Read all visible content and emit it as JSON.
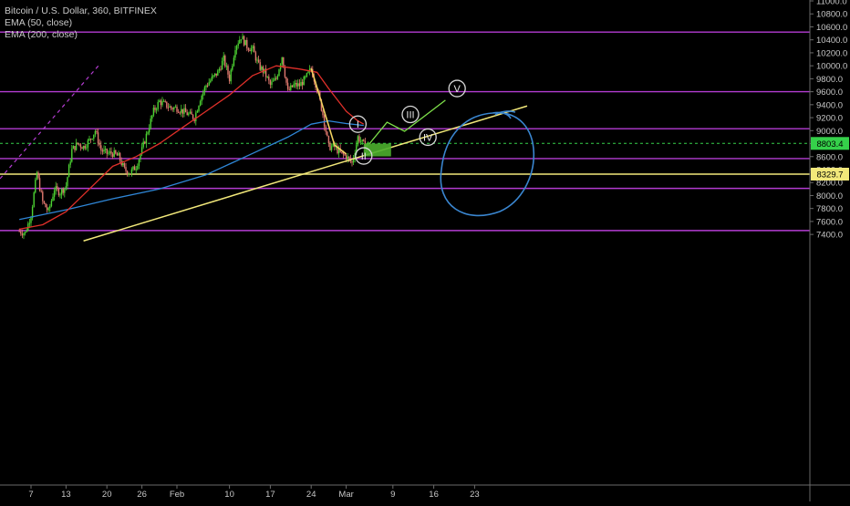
{
  "header": {
    "title": "Bitcoin / U.S. Dollar, 360, BITFINEX",
    "ema50_label": "EMA (50, close)",
    "ema200_label": "EMA (200, close)"
  },
  "colors": {
    "background": "#000000",
    "text": "#c8c8c8",
    "candle_up": "#4cd232",
    "candle_down": "#e0786e",
    "ema50": "#e0302a",
    "ema200": "#2f86d6",
    "levels": "#b43cd2",
    "trendline": "#f2e87a",
    "current_price_line": "#35d04a",
    "wave_annotation": "#7ee04a",
    "circle_annotation": "#3a86d0"
  },
  "chart_data": {
    "type": "candlestick",
    "title": "Bitcoin / U.S. Dollar, 360, BITFINEX",
    "xlabel": "",
    "ylabel": "",
    "ylim": [
      7300,
      11100
    ],
    "y_ticks": [
      "11000.0",
      "10800.0",
      "10600.0",
      "10400.0",
      "10200.0",
      "10000.0",
      "9800.0",
      "9600.0",
      "9400.0",
      "9200.0",
      "9000.0",
      "8800.0",
      "8600.0",
      "8400.0",
      "8200.0",
      "8000.0",
      "7800.0",
      "7600.0",
      "7400.0"
    ],
    "x_ticks": [
      "7",
      "13",
      "20",
      "26",
      "Feb",
      "10",
      "17",
      "24",
      "Mar",
      "9",
      "16",
      "23"
    ],
    "series": [
      {
        "name": "EMA (50, close)"
      },
      {
        "name": "EMA (200, close)"
      }
    ],
    "price_path": [
      [
        "Jan 5",
        7450
      ],
      [
        "Jan 6",
        7420
      ],
      [
        "Jan 7",
        7700
      ],
      [
        "Jan 8",
        8350
      ],
      [
        "Jan 9",
        7900
      ],
      [
        "Jan 10",
        7750
      ],
      [
        "Jan 11",
        8100
      ],
      [
        "Jan 12",
        8050
      ],
      [
        "Jan 13",
        8150
      ],
      [
        "Jan 14",
        8700
      ],
      [
        "Jan 15",
        8800
      ],
      [
        "Jan 16",
        8750
      ],
      [
        "Jan 17",
        8850
      ],
      [
        "Jan 18",
        9000
      ],
      [
        "Jan 19",
        8700
      ],
      [
        "Jan 20",
        8650
      ],
      [
        "Jan 21",
        8650
      ],
      [
        "Jan 22",
        8600
      ],
      [
        "Jan 23",
        8400
      ],
      [
        "Jan 24",
        8350
      ],
      [
        "Jan 25",
        8450
      ],
      [
        "Jan 26",
        8700
      ],
      [
        "Jan 27",
        9000
      ],
      [
        "Jan 28",
        9300
      ],
      [
        "Jan 29",
        9450
      ],
      [
        "Jan 30",
        9400
      ],
      [
        "Jan 31",
        9350
      ],
      [
        "Feb 1",
        9350
      ],
      [
        "Feb 2",
        9300
      ],
      [
        "Feb 3",
        9250
      ],
      [
        "Feb 4",
        9200
      ],
      [
        "Feb 5",
        9500
      ],
      [
        "Feb 6",
        9700
      ],
      [
        "Feb 7",
        9800
      ],
      [
        "Feb 8",
        9900
      ],
      [
        "Feb 9",
        10100
      ],
      [
        "Feb 10",
        9800
      ],
      [
        "Feb 11",
        10300
      ],
      [
        "Feb 12",
        10450
      ],
      [
        "Feb 13",
        10300
      ],
      [
        "Feb 14",
        10250
      ],
      [
        "Feb 15",
        10000
      ],
      [
        "Feb 16",
        9900
      ],
      [
        "Feb 17",
        9700
      ],
      [
        "Feb 18",
        9800
      ],
      [
        "Feb 19",
        10150
      ],
      [
        "Feb 20",
        9600
      ],
      [
        "Feb 21",
        9700
      ],
      [
        "Feb 22",
        9700
      ],
      [
        "Feb 23",
        9800
      ],
      [
        "Feb 24",
        9950
      ],
      [
        "Feb 25",
        9650
      ],
      [
        "Feb 26",
        9250
      ],
      [
        "Feb 27",
        8750
      ],
      [
        "Feb 28",
        8750
      ],
      [
        "Feb 29",
        8650
      ],
      [
        "Mar 1",
        8600
      ],
      [
        "Mar 2",
        8500
      ],
      [
        "Mar 3",
        8900
      ],
      [
        "Mar 4",
        8780
      ],
      [
        "Mar 5",
        8800
      ]
    ],
    "ema50": [
      [
        "Jan 5",
        7480
      ],
      [
        "Jan 9",
        7550
      ],
      [
        "Jan 13",
        7750
      ],
      [
        "Jan 17",
        8100
      ],
      [
        "Jan 21",
        8450
      ],
      [
        "Jan 25",
        8600
      ],
      [
        "Jan 29",
        8800
      ],
      [
        "Feb 2",
        9050
      ],
      [
        "Feb 6",
        9300
      ],
      [
        "Feb 10",
        9550
      ],
      [
        "Feb 14",
        9850
      ],
      [
        "Feb 18",
        10000
      ],
      [
        "Feb 22",
        9950
      ],
      [
        "Feb 25",
        9900
      ],
      [
        "Feb 27",
        9650
      ],
      [
        "Mar 1",
        9300
      ],
      [
        "Mar 3",
        9150
      ],
      [
        "Mar 4",
        9100
      ]
    ],
    "ema200": [
      [
        "Jan 5",
        7630
      ],
      [
        "Jan 13",
        7780
      ],
      [
        "Jan 21",
        7950
      ],
      [
        "Jan 29",
        8100
      ],
      [
        "Feb 6",
        8320
      ],
      [
        "Feb 14",
        8650
      ],
      [
        "Feb 20",
        8900
      ],
      [
        "Feb 24",
        9100
      ],
      [
        "Feb 27",
        9150
      ],
      [
        "Mar 1",
        9110
      ],
      [
        "Mar 4",
        9080
      ]
    ],
    "horizontal_levels": [
      10520,
      9600,
      9030,
      8570,
      8110,
      7460
    ],
    "highlighted_level": {
      "value": 8329.7,
      "label": "8329.7"
    },
    "current_price": {
      "value": 8803.4,
      "label": "8803.4"
    },
    "trendline": {
      "from": [
        "Jan 16",
        7300
      ],
      "to": [
        "Apr 1",
        9380
      ]
    },
    "wave_labels": [
      "I",
      "II",
      "III",
      "IV",
      "V"
    ]
  }
}
